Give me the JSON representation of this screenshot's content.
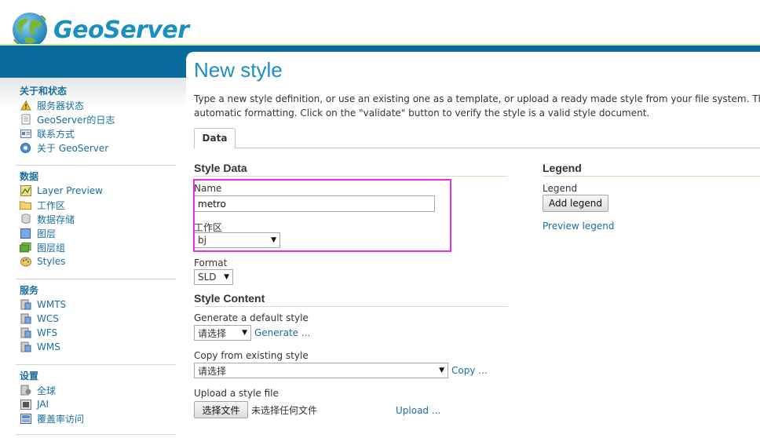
{
  "brand": {
    "name": "GeoServer"
  },
  "sidebar": {
    "sections": [
      {
        "title": "关于和状态",
        "items": [
          {
            "label": "服务器状态",
            "icon": "server-status-icon"
          },
          {
            "label": "GeoServer的日志",
            "icon": "log-icon"
          },
          {
            "label": "联系方式",
            "icon": "contact-icon"
          },
          {
            "label": "关于 GeoServer",
            "icon": "about-icon"
          }
        ]
      },
      {
        "title": "数据",
        "items": [
          {
            "label": "Layer Preview",
            "icon": "layer-preview-icon"
          },
          {
            "label": "工作区",
            "icon": "folder-icon"
          },
          {
            "label": "数据存储",
            "icon": "database-icon"
          },
          {
            "label": "图层",
            "icon": "layer-icon"
          },
          {
            "label": "图层组",
            "icon": "layer-group-icon"
          },
          {
            "label": "Styles",
            "icon": "styles-icon"
          }
        ]
      },
      {
        "title": "服务",
        "items": [
          {
            "label": "WMTS",
            "icon": "service-icon"
          },
          {
            "label": "WCS",
            "icon": "service-icon"
          },
          {
            "label": "WFS",
            "icon": "service-icon"
          },
          {
            "label": "WMS",
            "icon": "service-icon"
          }
        ]
      },
      {
        "title": "设置",
        "items": [
          {
            "label": "全球",
            "icon": "global-settings-icon"
          },
          {
            "label": "JAI",
            "icon": "jai-icon"
          },
          {
            "label": "覆盖率访问",
            "icon": "coverage-access-icon"
          }
        ]
      }
    ]
  },
  "main": {
    "title": "New style",
    "description_line1": "Type a new style definition, or use an existing one as a template, or upload a ready made style from your file system. The editor can provide syntax highlighting and",
    "description_line2": "automatic formatting. Click on the \"validate\" button to verify the style is a valid style document.",
    "tab": "Data"
  },
  "style_data": {
    "title": "Style Data",
    "name_label": "Name",
    "name_value": "metro",
    "workspace_label": "工作区",
    "workspace_value": "bj",
    "format_label": "Format",
    "format_value": "SLD"
  },
  "style_content": {
    "title": "Style Content",
    "generate_label": "Generate a default style",
    "generate_select": "请选择",
    "generate_link": "Generate ...",
    "copy_label": "Copy from existing style",
    "copy_select": "请选择",
    "copy_link": "Copy ...",
    "upload_label": "Upload a style file",
    "choose_file_button": "选择文件",
    "no_file_text": "未选择任何文件",
    "upload_link": "Upload ..."
  },
  "legend": {
    "title": "Legend",
    "label": "Legend",
    "add_button": "Add legend",
    "preview_link": "Preview legend"
  },
  "colors": {
    "accent": "#1a8fc0",
    "link": "#1a6e9e",
    "band": "#0a6a9b",
    "highlight": "#e62ee6"
  }
}
